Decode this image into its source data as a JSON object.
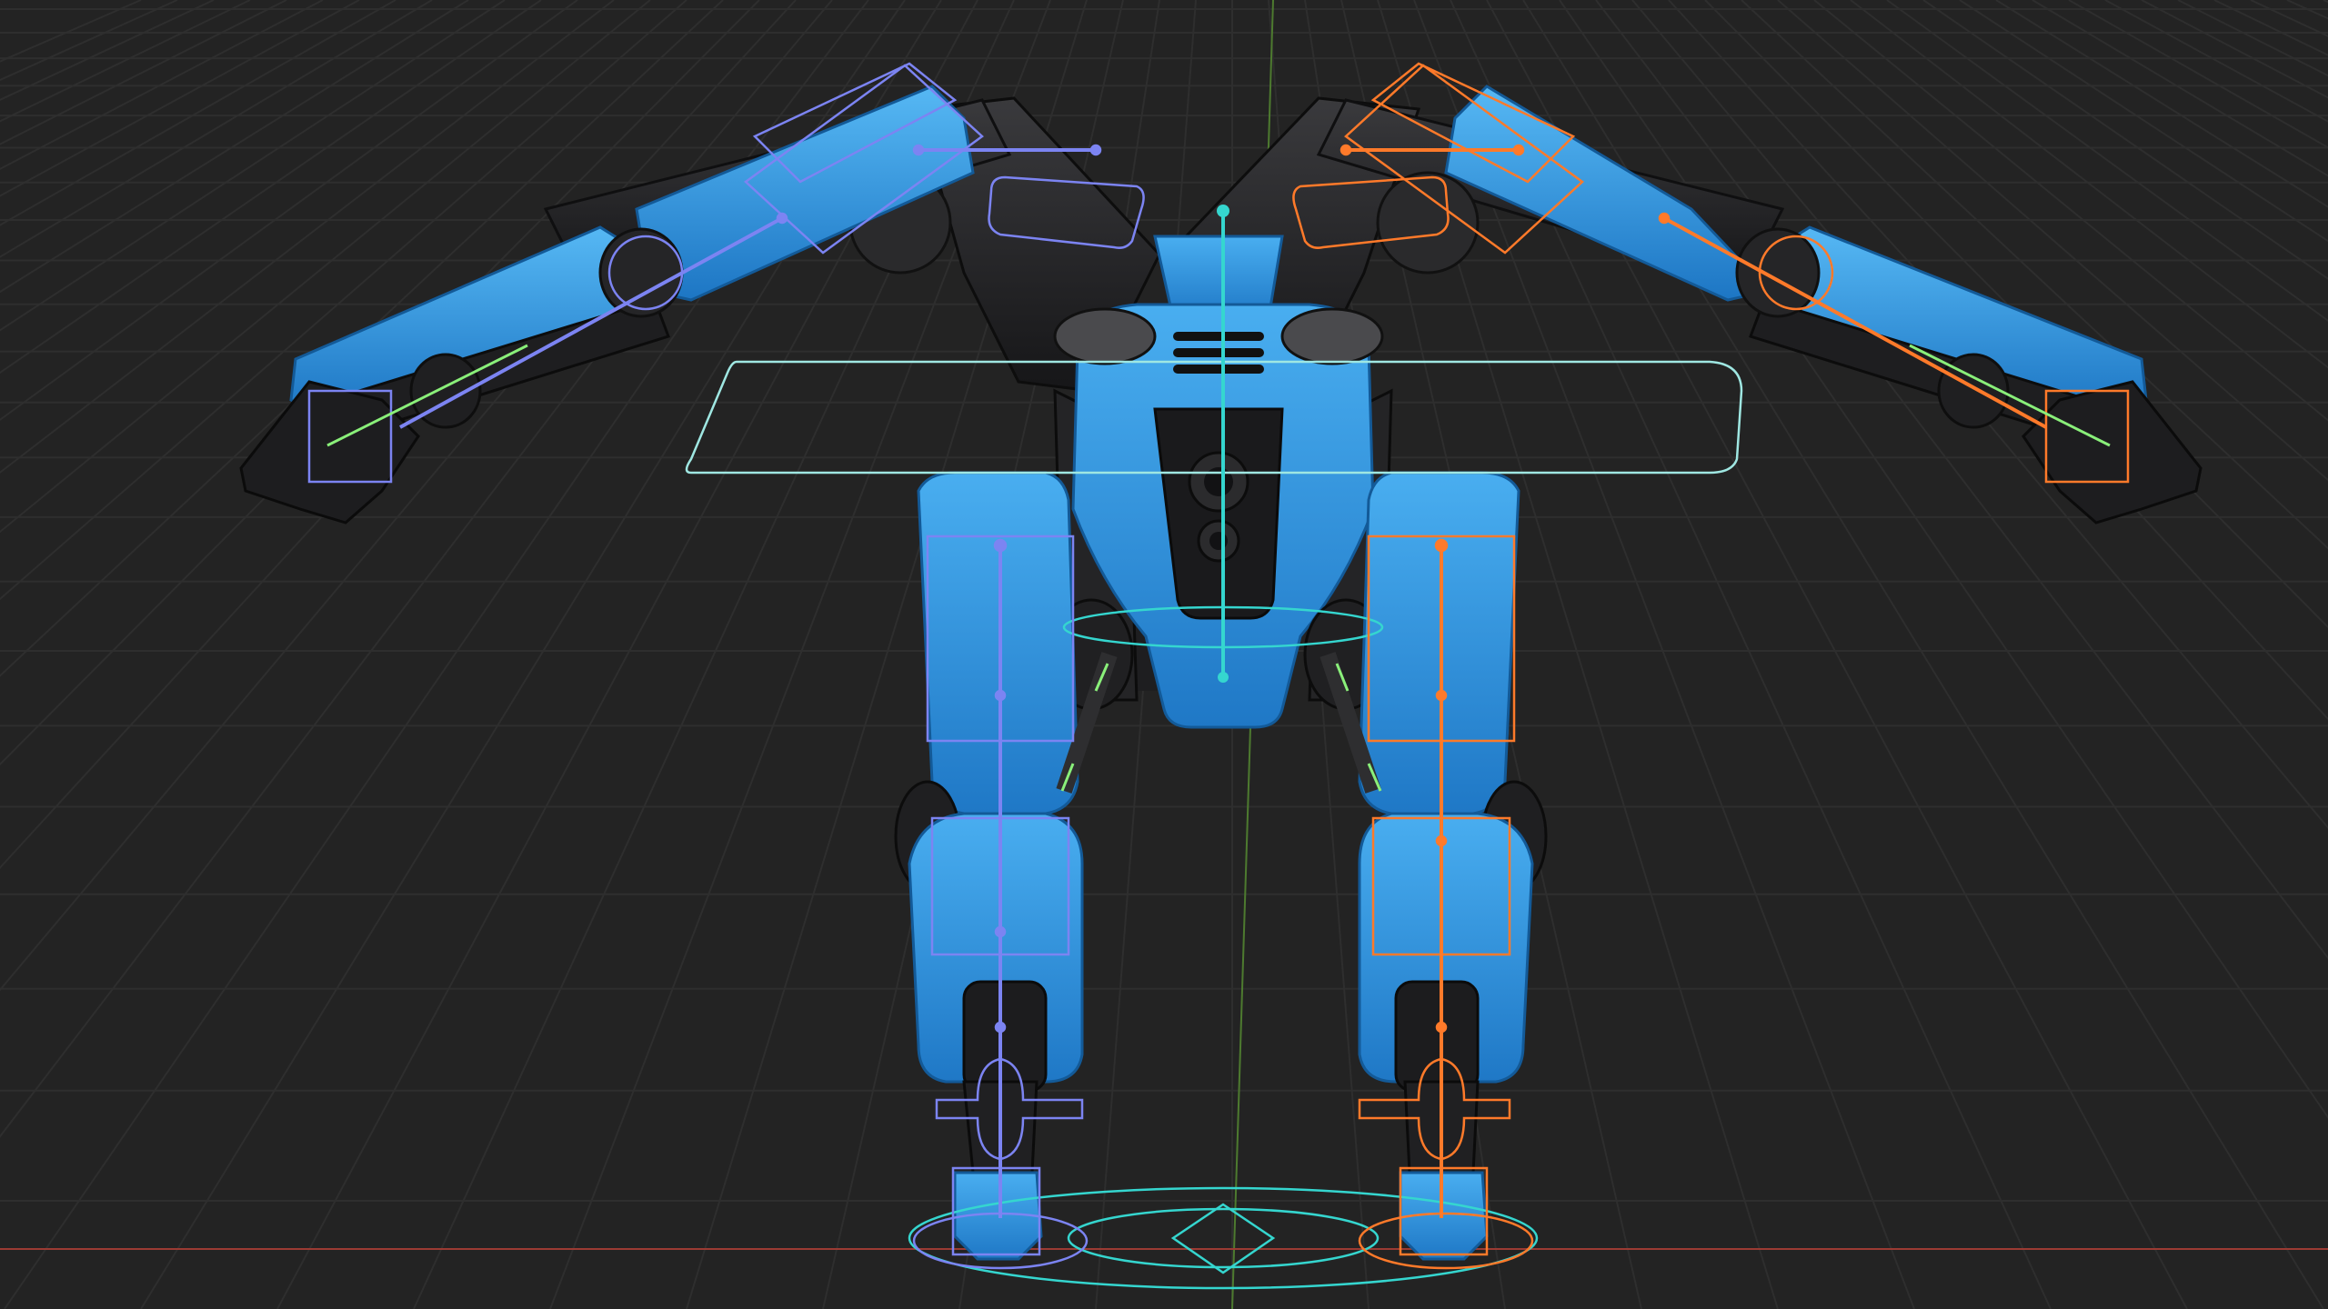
{
  "viewport": {
    "background": "#232323",
    "grid_color": "#2e2e2e",
    "x_axis_color": "#9b3b33",
    "y_axis_color": "#4d7a2f"
  },
  "robot": {
    "body_color": "#2f8fdc",
    "body_highlight": "#4fb0f0",
    "dark_part_color": "#1c1c1e",
    "mid_part_color": "#3a3a3c"
  },
  "rig": {
    "left_color": "#7c84f2",
    "right_color": "#ff7a2a",
    "center_color": "#35d6cf",
    "ik_color": "#8af07a",
    "control_color": "#9fe7e2"
  }
}
